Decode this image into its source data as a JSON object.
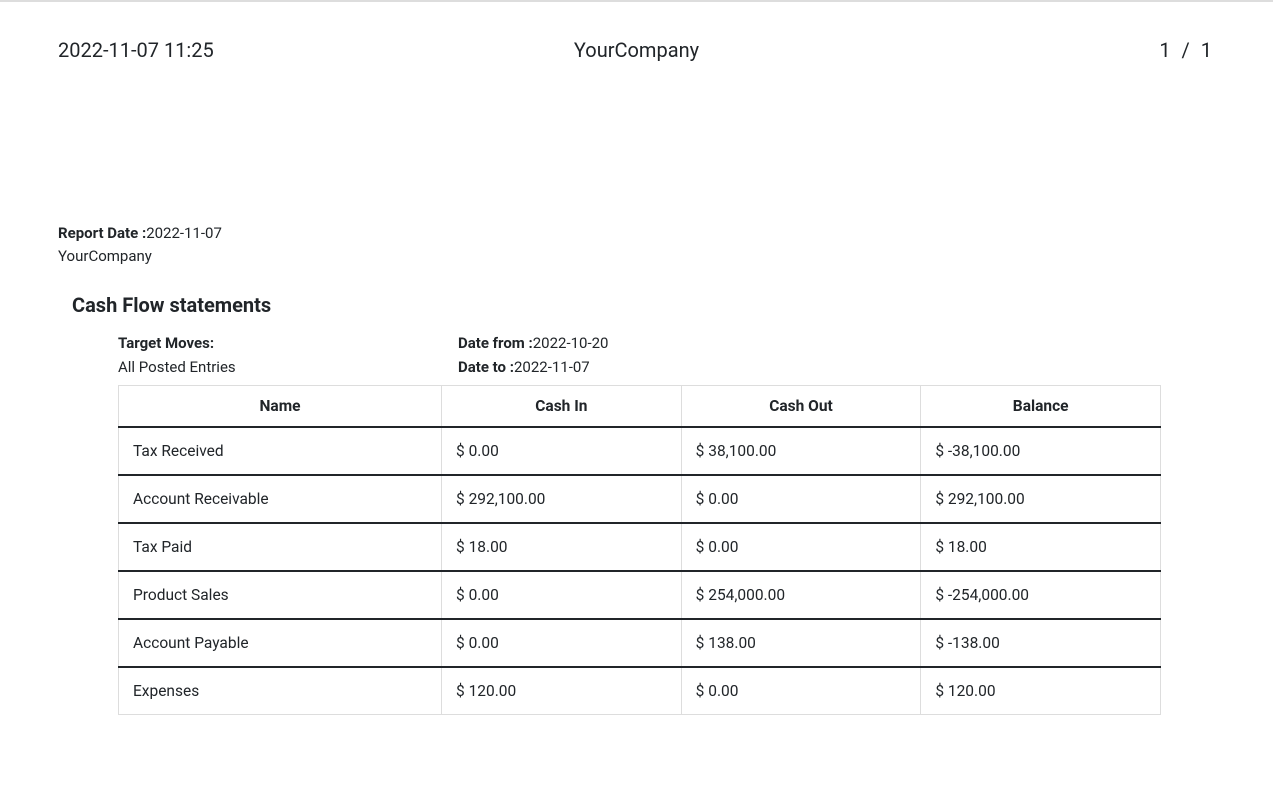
{
  "header": {
    "timestamp": "2022-11-07 11:25",
    "company": "YourCompany",
    "page": "1  /  1"
  },
  "meta": {
    "report_date_label": "Report Date :",
    "report_date_value": "2022-11-07",
    "company": "YourCompany"
  },
  "report": {
    "title": "Cash Flow statements",
    "target_moves_label": "Target Moves:",
    "target_moves_value": "All Posted Entries",
    "date_from_label": "Date from :",
    "date_from_value": "2022-10-20",
    "date_to_label": "Date to :",
    "date_to_value": "2022-11-07"
  },
  "table": {
    "headers": {
      "name": "Name",
      "cash_in": "Cash In",
      "cash_out": "Cash Out",
      "balance": "Balance"
    },
    "rows": [
      {
        "name": "Tax Received",
        "cash_in": "$ 0.00",
        "cash_out": "$ 38,100.00",
        "balance": "$ -38,100.00"
      },
      {
        "name": "Account Receivable",
        "cash_in": "$ 292,100.00",
        "cash_out": "$ 0.00",
        "balance": "$ 292,100.00"
      },
      {
        "name": "Tax Paid",
        "cash_in": "$ 18.00",
        "cash_out": "$ 0.00",
        "balance": "$ 18.00"
      },
      {
        "name": "Product Sales",
        "cash_in": "$ 0.00",
        "cash_out": "$ 254,000.00",
        "balance": "$ -254,000.00"
      },
      {
        "name": "Account Payable",
        "cash_in": "$ 0.00",
        "cash_out": "$ 138.00",
        "balance": "$ -138.00"
      },
      {
        "name": "Expenses",
        "cash_in": "$ 120.00",
        "cash_out": "$ 0.00",
        "balance": "$ 120.00"
      }
    ]
  }
}
